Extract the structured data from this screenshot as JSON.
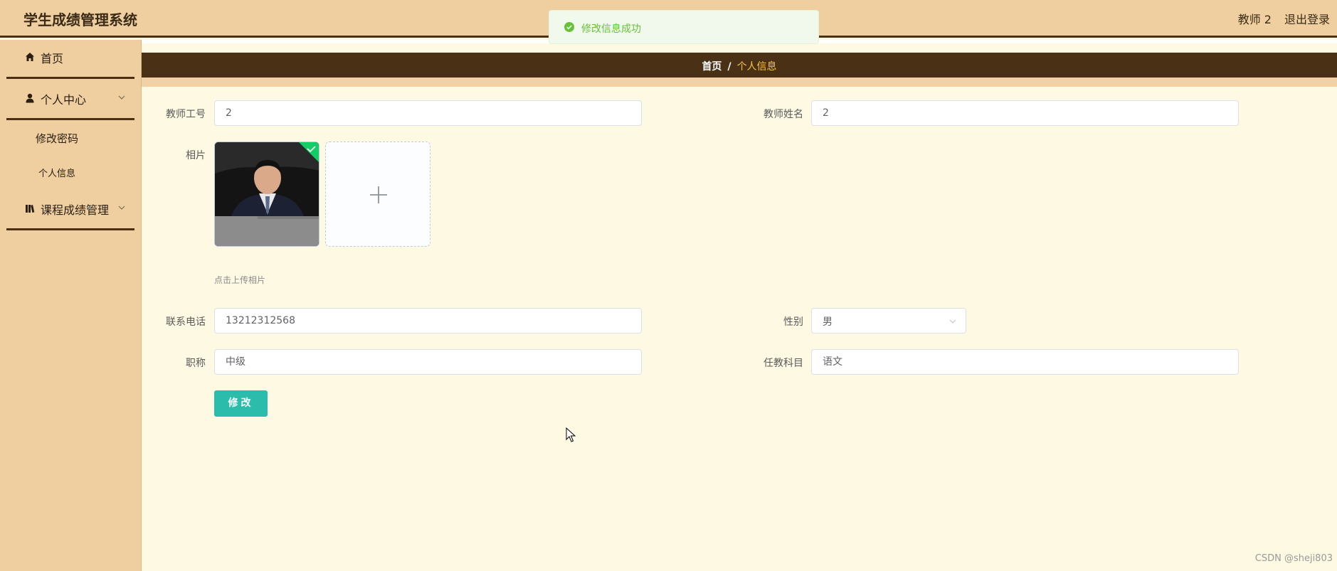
{
  "header": {
    "app_title": "学生成绩管理系统",
    "user_name": "教师 2",
    "logout_label": "退出登录"
  },
  "sidebar": {
    "items": [
      {
        "label": "首页",
        "icon": "home-icon"
      },
      {
        "label": "个人中心",
        "icon": "user-icon"
      },
      {
        "label": "课程成绩管理",
        "icon": "book-icon"
      }
    ],
    "sub_items": [
      "修改密码",
      "个人信息"
    ]
  },
  "breadcrumb": {
    "home": "首页",
    "separator": "/",
    "current": "个人信息"
  },
  "toast": {
    "message": "修改信息成功",
    "icon": "check-circle-icon"
  },
  "form": {
    "teacher_id_label": "教师工号",
    "teacher_id_value": "2",
    "teacher_name_label": "教师姓名",
    "teacher_name_value": "2",
    "photo_label": "相片",
    "upload_tip": "点击上传相片",
    "phone_label": "联系电话",
    "phone_value": "13212312568",
    "gender_label": "性别",
    "gender_value": "男",
    "title_label": "职称",
    "title_value": "中级",
    "subject_label": "任教科目",
    "subject_value": "语文",
    "submit_label": "修改"
  },
  "watermark": "CSDN @sheji803",
  "colors": {
    "header_bg": "#efcfa0",
    "dark_brown": "#4a2f14",
    "content_bg": "#fdf9e2",
    "accent_gold": "#f5c445",
    "button_teal": "#2bbcab",
    "success_green": "#67c23a"
  }
}
